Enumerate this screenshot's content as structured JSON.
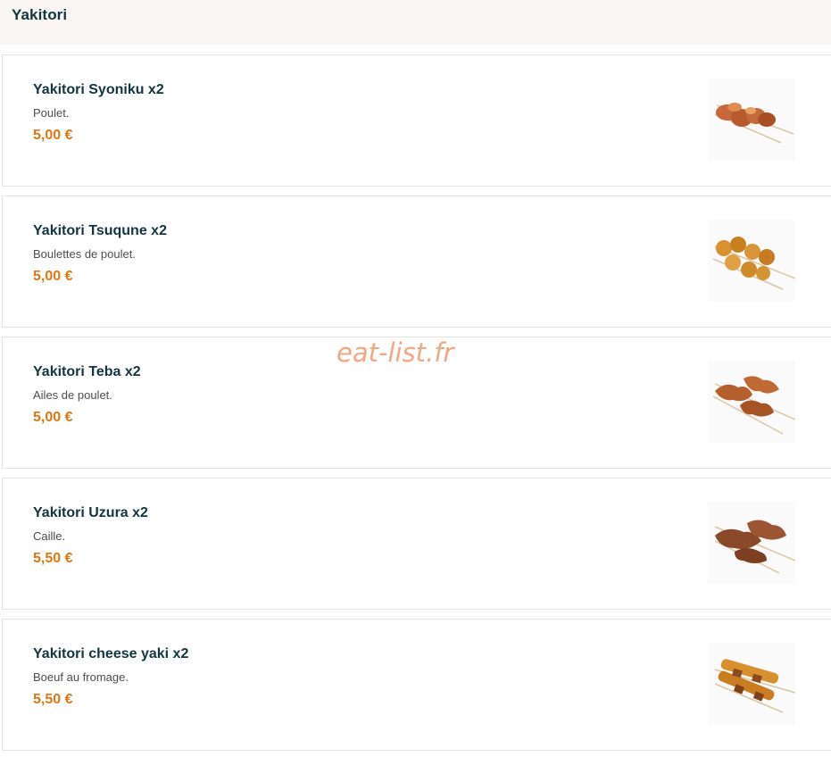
{
  "section": {
    "title": "Yakitori"
  },
  "items": [
    {
      "name": "Yakitori Syoniku x2",
      "description": "Poulet.",
      "price": "5,00 €",
      "image_icon": "skewer-chicken-image"
    },
    {
      "name": "Yakitori Tsuqune x2",
      "description": "Boulettes de poulet.",
      "price": "5,00 €",
      "image_icon": "skewer-meatball-image"
    },
    {
      "name": "Yakitori Teba x2",
      "description": "Ailes de poulet.",
      "price": "5,00 €",
      "image_icon": "skewer-wing-image"
    },
    {
      "name": "Yakitori Uzura x2",
      "description": "Caille.",
      "price": "5,50 €",
      "image_icon": "skewer-quail-image"
    },
    {
      "name": "Yakitori cheese yaki x2",
      "description": "Boeuf au fromage.",
      "price": "5,50 €",
      "image_icon": "skewer-cheese-beef-image"
    }
  ],
  "watermark": "eat-list.fr",
  "colors": {
    "header_bg": "#f8f5f2",
    "title": "#12363f",
    "price": "#e07612",
    "watermark": "#f4a27d"
  }
}
